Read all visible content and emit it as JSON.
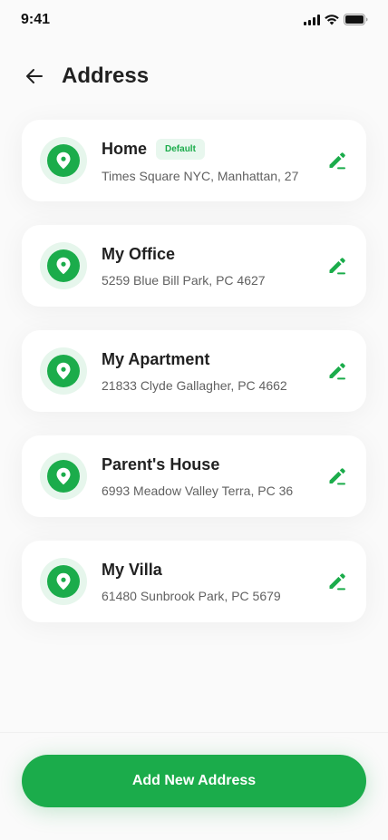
{
  "status_bar": {
    "time": "9:41"
  },
  "header": {
    "title": "Address"
  },
  "addresses": [
    {
      "name": "Home",
      "badge": "Default",
      "address": "Times Square NYC, Manhattan, 27"
    },
    {
      "name": "My Office",
      "address": "5259 Blue Bill Park, PC 4627"
    },
    {
      "name": "My Apartment",
      "address": "21833 Clyde Gallagher, PC 4662"
    },
    {
      "name": "Parent's House",
      "address": "6993 Meadow Valley Terra, PC 36"
    },
    {
      "name": "My Villa",
      "address": "61480 Sunbrook Park, PC 5679"
    }
  ],
  "footer": {
    "add_button_label": "Add New Address"
  },
  "colors": {
    "accent": "#1bac4b",
    "accent_light": "#e6f6ec",
    "text_primary": "#212121",
    "text_secondary": "#616161"
  },
  "icons": {
    "back": "arrow-left-icon",
    "location": "location-pin-icon",
    "edit": "edit-pencil-icon",
    "signal": "signal-icon",
    "wifi": "wifi-icon",
    "battery": "battery-icon"
  }
}
